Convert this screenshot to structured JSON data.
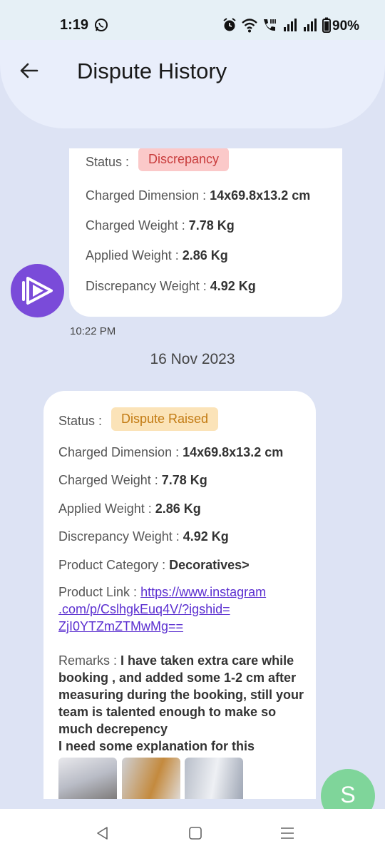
{
  "status_bar": {
    "time": "1:19",
    "battery": "90%",
    "icons": [
      "whatsapp-icon",
      "alarm-icon",
      "wifi-icon",
      "call-icon",
      "signal-icon",
      "signal-icon",
      "battery-icon"
    ]
  },
  "header": {
    "title": "Dispute History",
    "back_icon": "back-arrow-icon"
  },
  "messages": [
    {
      "status_label": "Status :",
      "status_value": "Discrepancy",
      "charged_dimension_label": "Charged Dimension : ",
      "charged_dimension_value": "14x69.8x13.2 cm",
      "charged_weight_label": "Charged Weight : ",
      "charged_weight_value": "7.78 Kg",
      "applied_weight_label": "Applied Weight : ",
      "applied_weight_value": "2.86 Kg",
      "discrepancy_weight_label": "Discrepancy Weight : ",
      "discrepancy_weight_value": "4.92 Kg",
      "time": "10:22 PM"
    },
    {
      "status_label": "Status :",
      "status_value": "Dispute Raised",
      "charged_dimension_label": "Charged Dimension : ",
      "charged_dimension_value": "14x69.8x13.2 cm",
      "charged_weight_label": "Charged Weight : ",
      "charged_weight_value": "7.78 Kg",
      "applied_weight_label": "Applied Weight : ",
      "applied_weight_value": "2.86 Kg",
      "discrepancy_weight_label": "Discrepancy Weight : ",
      "discrepancy_weight_value": "4.92 Kg",
      "product_category_label": "Product Category : ",
      "product_category_value": "Decoratives>",
      "product_link_label": "Product Link : ",
      "product_link_line1": "https://www.instagram",
      "product_link_line2": ".com/p/CslhgkEuq4V/?igshid=",
      "product_link_line3": "ZjI0YTZmZTMwMg==",
      "remarks_label": "Remarks : ",
      "remarks_text": "I have taken extra care while booking , and added some 1-2 cm after measuring during the booking, still your team is talented enough to make so much decrepency",
      "remarks_text2": "I need some explanation for this"
    }
  ],
  "date_separator": "16 Nov 2023",
  "fab": {
    "letter": "S",
    "color": "#7fd59a"
  },
  "colors": {
    "accent": "#7a4bd9",
    "background": "#dde3f4",
    "discrepancy": "#c83c3c",
    "dispute_raised": "#c27a12"
  },
  "nav": {
    "icons": [
      "nav-back-icon",
      "nav-home-icon",
      "nav-menu-icon"
    ]
  }
}
